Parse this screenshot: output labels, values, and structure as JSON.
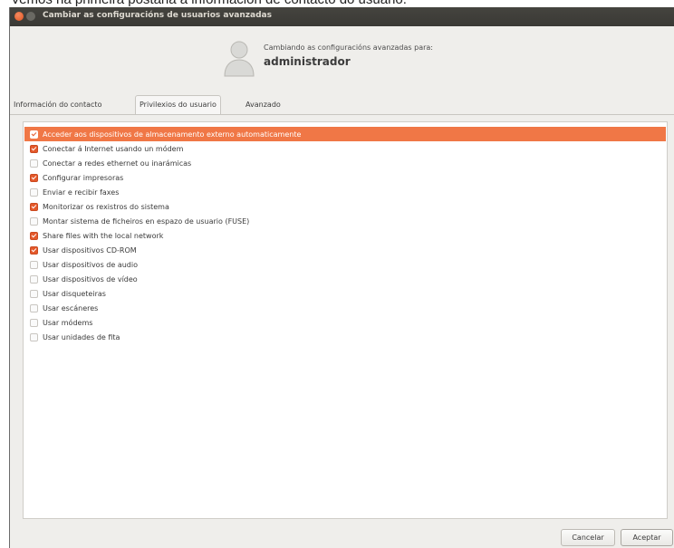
{
  "caption": "Vemos na primeira postana a información de contacto do usuario.",
  "window": {
    "title": "Cambiar as configuracións de usuarios avanzadas"
  },
  "header": {
    "subtitle": "Cambiando as configuracións avanzadas para:",
    "username": "administrador",
    "avatar_icon": "user-avatar-icon"
  },
  "tabs": [
    {
      "label": "Información do contacto",
      "active": false
    },
    {
      "label": "Privilexios do usuario",
      "active": true
    },
    {
      "label": "Avanzado",
      "active": false
    }
  ],
  "privileges": [
    {
      "label": "Acceder aos dispositivos de almacenamento externo automaticamente",
      "checked": true,
      "selected": true
    },
    {
      "label": "Conectar á Internet usando un módem",
      "checked": true,
      "selected": false
    },
    {
      "label": "Conectar a redes ethernet ou inarámicas",
      "checked": false,
      "selected": false
    },
    {
      "label": "Configurar impresoras",
      "checked": true,
      "selected": false
    },
    {
      "label": "Enviar e recibir faxes",
      "checked": false,
      "selected": false
    },
    {
      "label": "Monitorizar os rexistros do sistema",
      "checked": true,
      "selected": false
    },
    {
      "label": "Montar sistema de ficheiros en espazo de usuario (FUSE)",
      "checked": false,
      "selected": false
    },
    {
      "label": "Share files with the local network",
      "checked": true,
      "selected": false
    },
    {
      "label": "Usar dispositivos CD-ROM",
      "checked": true,
      "selected": false
    },
    {
      "label": "Usar dispositivos de audio",
      "checked": false,
      "selected": false
    },
    {
      "label": "Usar dispositivos de vídeo",
      "checked": false,
      "selected": false
    },
    {
      "label": "Usar disqueteiras",
      "checked": false,
      "selected": false
    },
    {
      "label": "Usar escáneres",
      "checked": false,
      "selected": false
    },
    {
      "label": "Usar módems",
      "checked": false,
      "selected": false
    },
    {
      "label": "Usar unidades de fita",
      "checked": false,
      "selected": false
    }
  ],
  "buttons": {
    "cancel": "Cancelar",
    "ok": "Aceptar"
  },
  "colors": {
    "selection": "#f07746",
    "checkbox_checked": "#e4582a",
    "titlebar": "#3c3b37"
  }
}
